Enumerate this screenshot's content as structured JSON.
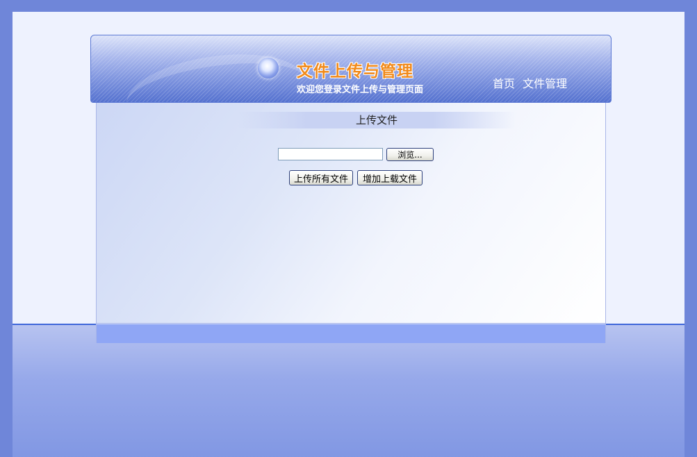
{
  "header": {
    "title": "文件上传与管理",
    "subtitle": "欢迎您登录文件上传与管理页面",
    "nav": [
      {
        "label": "首页"
      },
      {
        "label": "文件管理"
      }
    ]
  },
  "main": {
    "section_title": "上传文件",
    "file_input": {
      "value": "",
      "browse_label": "浏览..."
    },
    "buttons": {
      "upload_all": "上传所有文件",
      "add_file": "增加上载文件"
    }
  },
  "colors": {
    "background": "#6f86d9",
    "title_accent": "#f18a1a",
    "footer_bar": "#8fa6f5"
  }
}
